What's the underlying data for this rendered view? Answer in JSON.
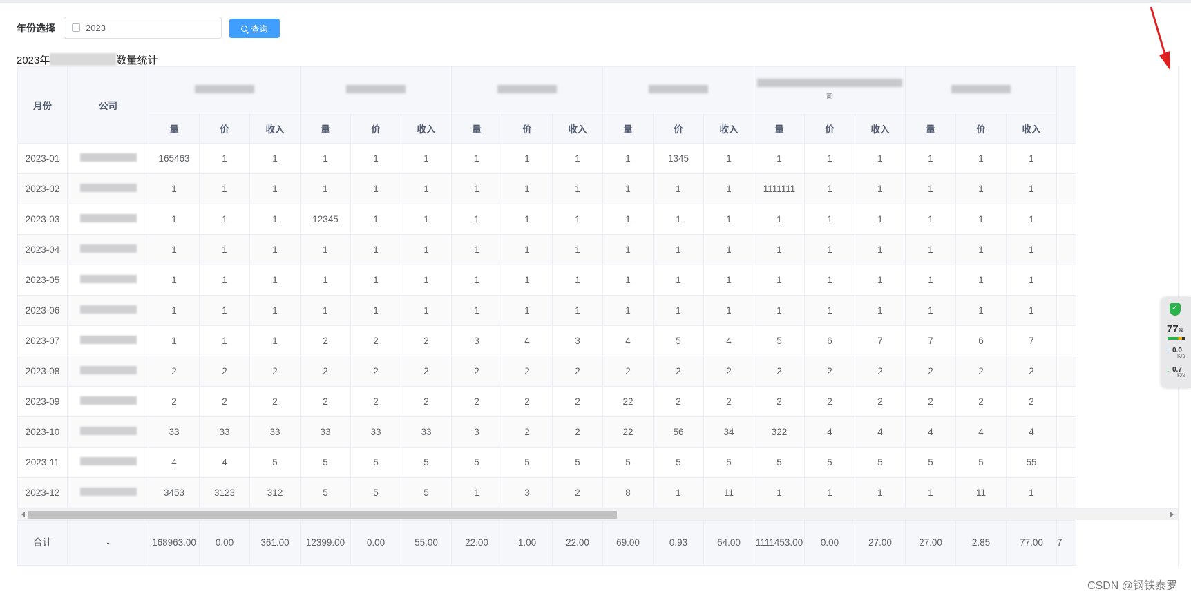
{
  "filter": {
    "label": "年份选择",
    "year_value": "2023",
    "query_label": "查询"
  },
  "title": {
    "prefix": "2023年",
    "suffix": "数量统计"
  },
  "headers": {
    "month": "月份",
    "company": "公司",
    "group_fragment": "司",
    "sub": [
      "量",
      "价",
      "收入"
    ]
  },
  "rows": [
    {
      "month": "2023-01",
      "values": [
        "165463",
        "1",
        "1",
        "1",
        "1",
        "1",
        "1",
        "1",
        "1",
        "1",
        "1345",
        "1",
        "1",
        "1",
        "1",
        "1",
        "1",
        "1"
      ]
    },
    {
      "month": "2023-02",
      "values": [
        "1",
        "1",
        "1",
        "1",
        "1",
        "1",
        "1",
        "1",
        "1",
        "1",
        "1",
        "1",
        "1111111",
        "1",
        "1",
        "1",
        "1",
        "1"
      ]
    },
    {
      "month": "2023-03",
      "values": [
        "1",
        "1",
        "1",
        "12345",
        "1",
        "1",
        "1",
        "1",
        "1",
        "1",
        "1",
        "1",
        "1",
        "1",
        "1",
        "1",
        "1",
        "1"
      ]
    },
    {
      "month": "2023-04",
      "values": [
        "1",
        "1",
        "1",
        "1",
        "1",
        "1",
        "1",
        "1",
        "1",
        "1",
        "1",
        "1",
        "1",
        "1",
        "1",
        "1",
        "1",
        "1"
      ]
    },
    {
      "month": "2023-05",
      "values": [
        "1",
        "1",
        "1",
        "1",
        "1",
        "1",
        "1",
        "1",
        "1",
        "1",
        "1",
        "1",
        "1",
        "1",
        "1",
        "1",
        "1",
        "1"
      ]
    },
    {
      "month": "2023-06",
      "values": [
        "1",
        "1",
        "1",
        "1",
        "1",
        "1",
        "1",
        "1",
        "1",
        "1",
        "1",
        "1",
        "1",
        "1",
        "1",
        "1",
        "1",
        "1"
      ]
    },
    {
      "month": "2023-07",
      "values": [
        "1",
        "1",
        "1",
        "2",
        "2",
        "2",
        "3",
        "4",
        "3",
        "4",
        "5",
        "4",
        "5",
        "6",
        "7",
        "7",
        "6",
        "7"
      ]
    },
    {
      "month": "2023-08",
      "values": [
        "2",
        "2",
        "2",
        "2",
        "2",
        "2",
        "2",
        "2",
        "2",
        "2",
        "2",
        "2",
        "2",
        "2",
        "2",
        "2",
        "2",
        "2"
      ]
    },
    {
      "month": "2023-09",
      "values": [
        "2",
        "2",
        "2",
        "2",
        "2",
        "2",
        "2",
        "2",
        "2",
        "22",
        "2",
        "2",
        "2",
        "2",
        "2",
        "2",
        "2",
        "2"
      ]
    },
    {
      "month": "2023-10",
      "values": [
        "33",
        "33",
        "33",
        "33",
        "33",
        "33",
        "3",
        "2",
        "2",
        "22",
        "56",
        "34",
        "322",
        "4",
        "4",
        "4",
        "4",
        "4"
      ]
    },
    {
      "month": "2023-11",
      "values": [
        "4",
        "4",
        "5",
        "5",
        "5",
        "5",
        "5",
        "5",
        "5",
        "5",
        "5",
        "5",
        "5",
        "5",
        "5",
        "5",
        "5",
        "55"
      ]
    },
    {
      "month": "2023-12",
      "values": [
        "3453",
        "3123",
        "312",
        "5",
        "5",
        "5",
        "1",
        "3",
        "2",
        "8",
        "1",
        "11",
        "1",
        "1",
        "1",
        "1",
        "11",
        "1"
      ]
    }
  ],
  "footer": {
    "label": "合计",
    "company": "-",
    "values": [
      "168963.00",
      "0.00",
      "361.00",
      "12399.00",
      "0.00",
      "55.00",
      "22.00",
      "1.00",
      "22.00",
      "69.00",
      "0.93",
      "64.00",
      "1111453.00",
      "0.00",
      "27.00",
      "27.00",
      "2.85",
      "77.00"
    ],
    "partial": "7"
  },
  "widget": {
    "percent": "77",
    "percent_unit": "%",
    "upload": "0.0",
    "download": "0.7",
    "rate_unit": "K/s"
  },
  "watermark": "CSDN @钢铁泰罗",
  "colors": {
    "primary": "#409eff",
    "header_bg": "#f5f7fa",
    "border": "#ebeef5",
    "annotation_arrow": "#e02020"
  }
}
